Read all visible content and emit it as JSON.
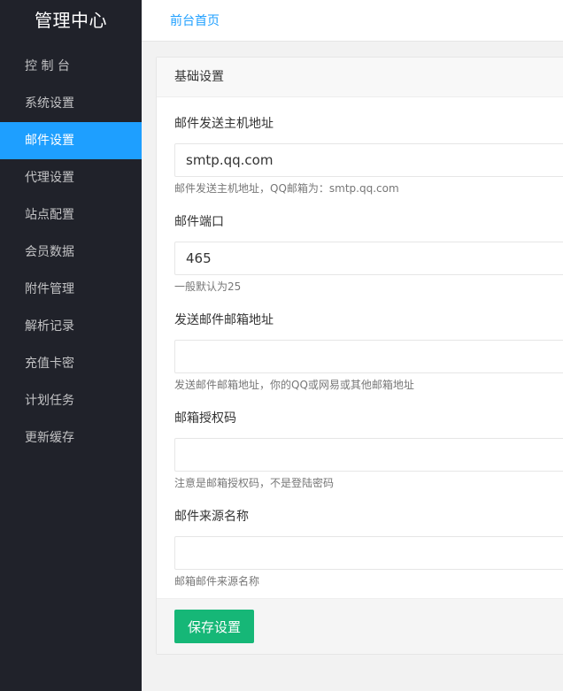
{
  "brand": "管理中心",
  "nav": [
    {
      "label": "控 制 台"
    },
    {
      "label": "系统设置"
    },
    {
      "label": "邮件设置"
    },
    {
      "label": "代理设置"
    },
    {
      "label": "站点配置"
    },
    {
      "label": "会员数据"
    },
    {
      "label": "附件管理"
    },
    {
      "label": "解析记录"
    },
    {
      "label": "充值卡密"
    },
    {
      "label": "计划任务"
    },
    {
      "label": "更新缓存"
    }
  ],
  "topbar": {
    "home_link": "前台首页"
  },
  "card": {
    "title": "基础设置"
  },
  "fields": [
    {
      "label": "邮件发送主机地址",
      "value": "smtp.qq.com",
      "help": "邮件发送主机地址，QQ邮箱为：smtp.qq.com"
    },
    {
      "label": "邮件端口",
      "value": "465",
      "help": "一般默认为25"
    },
    {
      "label": "发送邮件邮箱地址",
      "value": "",
      "help": "发送邮件邮箱地址，你的QQ或网易或其他邮箱地址"
    },
    {
      "label": "邮箱授权码",
      "value": "",
      "help": "注意是邮箱授权码，不是登陆密码"
    },
    {
      "label": "邮件来源名称",
      "value": "",
      "help": "邮箱邮件来源名称"
    }
  ],
  "footer": {
    "save_label": "保存设置"
  }
}
